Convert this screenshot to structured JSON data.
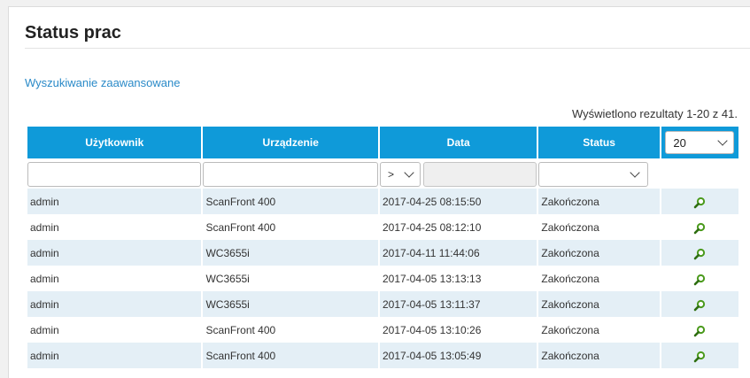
{
  "page": {
    "title": "Status prac",
    "advanced_search": "Wyszukiwanie zaawansowane",
    "results_info": "Wyświetlono rezultaty 1-20 z 41."
  },
  "table": {
    "columns": [
      "Użytkownik",
      "Urządzenie",
      "Data",
      "Status"
    ],
    "page_size": "20",
    "date_operator": ">",
    "rows": [
      {
        "user": "admin",
        "device": "ScanFront 400",
        "date": "2017-04-25 08:15:50",
        "status": "Zakończona"
      },
      {
        "user": "admin",
        "device": "ScanFront 400",
        "date": "2017-04-25 08:12:10",
        "status": "Zakończona"
      },
      {
        "user": "admin",
        "device": "WC3655i",
        "date": "2017-04-11 11:44:06",
        "status": "Zakończona"
      },
      {
        "user": "admin",
        "device": "WC3655i",
        "date": "2017-04-05 13:13:13",
        "status": "Zakończona"
      },
      {
        "user": "admin",
        "device": "WC3655i",
        "date": "2017-04-05 13:11:37",
        "status": "Zakończona"
      },
      {
        "user": "admin",
        "device": "ScanFront 400",
        "date": "2017-04-05 13:10:26",
        "status": "Zakończona"
      },
      {
        "user": "admin",
        "device": "ScanFront 400",
        "date": "2017-04-05 13:05:49",
        "status": "Zakończona"
      }
    ]
  },
  "colors": {
    "header_bg": "#0f9ad9",
    "row_alt": "#e4eff6",
    "link": "#2a8ac8",
    "icon_green": "#4a9a1c"
  },
  "icons": {
    "details": "magnifier-icon"
  }
}
